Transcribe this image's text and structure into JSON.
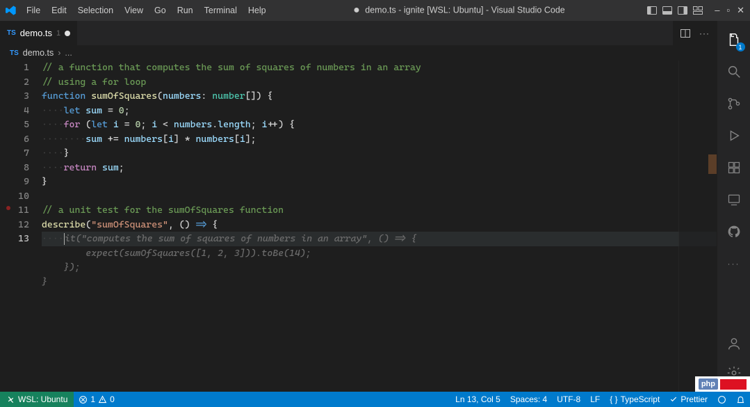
{
  "title": {
    "modified": "●",
    "filename": "demo.ts",
    "project": "ignite [WSL: Ubuntu]",
    "app": "Visual Studio Code"
  },
  "menu": [
    "File",
    "Edit",
    "Selection",
    "View",
    "Go",
    "Run",
    "Terminal",
    "Help"
  ],
  "tab": {
    "icon": "TS",
    "label": "demo.ts",
    "problems": "1",
    "modified": true
  },
  "breadcrumb": {
    "icon": "TS",
    "file": "demo.ts",
    "rest": "..."
  },
  "gutter": {
    "lines": [
      "1",
      "2",
      "3",
      "4",
      "5",
      "6",
      "7",
      "8",
      "9",
      "10",
      "11",
      "12",
      "13"
    ],
    "active": 13
  },
  "code": {
    "l1": "// a function that computes the sum of squares of numbers in an array",
    "l2": "// using a for loop",
    "l3_kw1": "function",
    "l3_fn": "sumOfSquares",
    "l3_open": "(",
    "l3_param": "numbers",
    "l3_colon": ": ",
    "l3_type": "number",
    "l3_close": "[]) {",
    "l4_kw": "let",
    "l4_var": "sum",
    "l4_eq": " = ",
    "l4_num": "0",
    "l4_semi": ";",
    "l5_for": "for",
    "l5_open": " (",
    "l5_let": "let",
    "l5_i": "i",
    "l5_eq": " = ",
    "l5_z": "0",
    "l5_semi": "; ",
    "l5_i2": "i",
    "l5_lt": " < ",
    "l5_nums": "numbers",
    "l5_dot": ".",
    "l5_len": "length",
    "l5_semi2": "; ",
    "l5_i3": "i",
    "l5_inc": "++) {",
    "l6_sum": "sum",
    "l6_pluseq": " += ",
    "l6_nums": "numbers",
    "l6_br1": "[",
    "l6_i": "i",
    "l6_br2": "] * ",
    "l6_nums2": "numbers",
    "l6_br3": "[",
    "l6_i2": "i",
    "l6_br4": "];",
    "l7": "}",
    "l8_ret": "return",
    "l8_sum": "sum",
    "l8_semi": ";",
    "l9": "}",
    "l10": "",
    "l11": "// a unit test for the sumOfSquares function",
    "l12_desc": "describe",
    "l12_open": "(",
    "l12_str": "\"sumOfSquares\"",
    "l12_rest": ", () ",
    "l12_arrow": "=>",
    "l12_brace": " {",
    "l13_ghost1": "it(\"computes the sum of squares of numbers in an array\", () => {",
    "l13_ghost2": "        expect(sumOfSquares([1, 2, 3])).toBe(14);",
    "l13_ghost3": "    });",
    "l13_ghost4": "}"
  },
  "activitybar": {
    "files_badge": "1"
  },
  "status": {
    "remote": "WSL: Ubuntu",
    "errors": "1",
    "warnings": "0",
    "ln_col": "Ln 13, Col 5",
    "spaces": "Spaces: 4",
    "encoding": "UTF-8",
    "eol": "LF",
    "language": "TypeScript",
    "prettier": "Prettier"
  },
  "watermark": {
    "text": "php"
  }
}
